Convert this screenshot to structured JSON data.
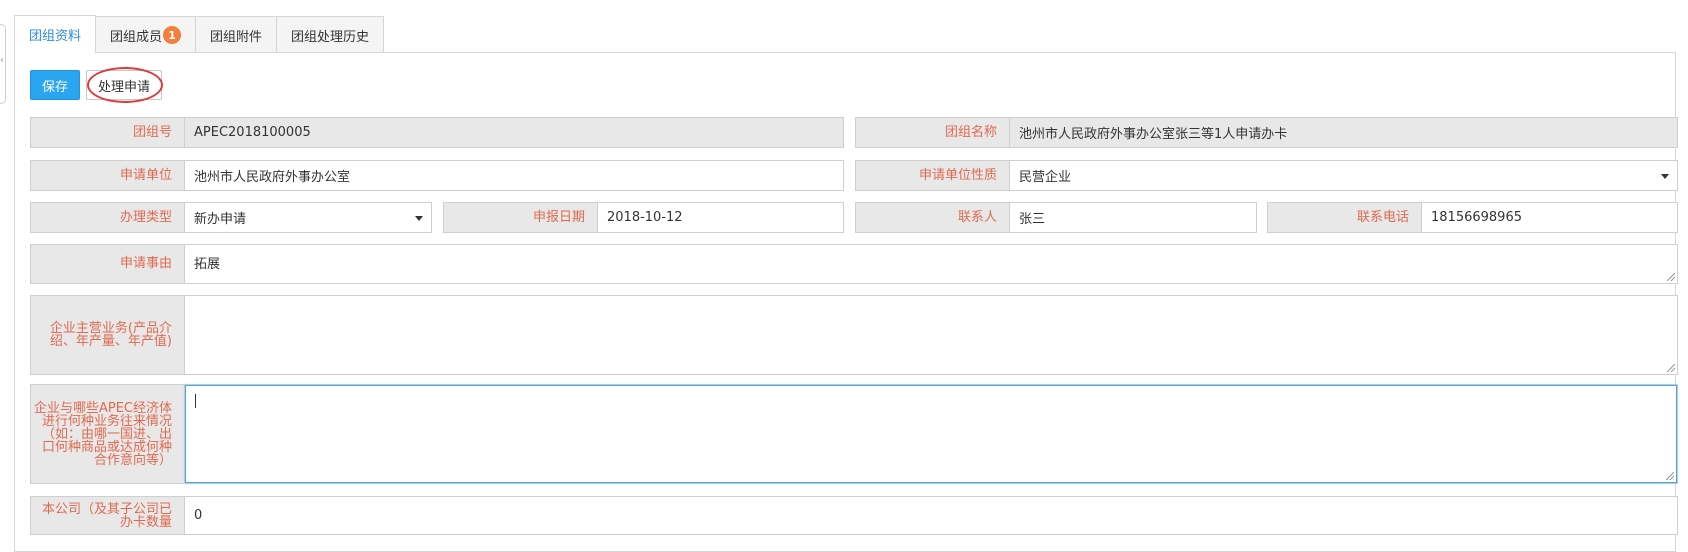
{
  "tabs": [
    {
      "label": "团组资料",
      "active": true
    },
    {
      "label": "团组成员",
      "badge": "1"
    },
    {
      "label": "团组附件"
    },
    {
      "label": "团组处理历史"
    }
  ],
  "toolbar": {
    "save_label": "保存",
    "process_label": "处理申请"
  },
  "form": {
    "group_no": {
      "label": "团组号",
      "value": "APEC2018100005"
    },
    "group_name": {
      "label": "团组名称",
      "value": "池州市人民政府外事办公室张三等1人申请办卡"
    },
    "applicant_unit": {
      "label": "申请单位",
      "value": "池州市人民政府外事办公室"
    },
    "unit_nature": {
      "label": "申请单位性质",
      "value": "民营企业"
    },
    "handle_type": {
      "label": "办理类型",
      "value": "新办申请"
    },
    "report_date": {
      "label": "申报日期",
      "value": "2018-10-12"
    },
    "contact": {
      "label": "联系人",
      "value": "张三"
    },
    "phone": {
      "label": "联系电话",
      "value": "18156698965"
    },
    "reason": {
      "label": "申请事由",
      "value": "拓展"
    },
    "main_business": {
      "label": "企业主营业务(产品介绍、年产量、年产值)",
      "value": ""
    },
    "apec_business": {
      "label": "企业与哪些APEC经济体进行何种业务往来情况（如：由哪一国进、出口何种商品或达成何种合作意向等）",
      "value": ""
    },
    "card_count": {
      "label": "本公司（及其子公司已办卡数量",
      "value": "0"
    }
  },
  "colors": {
    "accent": "#2aa5f0",
    "label_text": "#e06a50",
    "badge": "#f0803c",
    "circle": "#e03a3a"
  }
}
